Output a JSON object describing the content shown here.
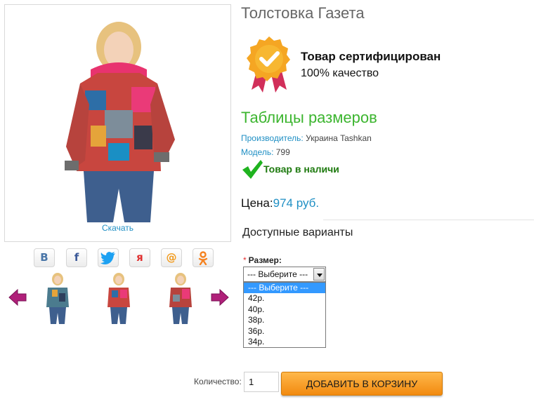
{
  "product": {
    "title": "Толстовка Газета",
    "download_label": "Скачать",
    "main_image_icon": "product-photo-girl-hoodie"
  },
  "share": {
    "buttons": [
      {
        "name": "vk",
        "glyph": "B",
        "color": "#4a76a8"
      },
      {
        "name": "facebook",
        "glyph": "f",
        "color": "#3b5998"
      },
      {
        "name": "twitter",
        "glyph": "🐦",
        "color": "#1da1f2"
      },
      {
        "name": "moimir",
        "glyph": "я",
        "color": "#e03030"
      },
      {
        "name": "mailru",
        "glyph": "@",
        "color": "#f29b1d"
      },
      {
        "name": "odnoklassniki",
        "glyph": "ok",
        "color": "#f58220"
      }
    ]
  },
  "certificate": {
    "title": "Товар сертифицирован",
    "subtitle": "100% качество"
  },
  "size_table_link": "Таблицы размеров",
  "meta": {
    "manufacturer_label": "Производитель:",
    "manufacturer_value": "Украина Tashkan",
    "model_label": "Модель:",
    "model_value": "799"
  },
  "stock": {
    "text": "Товар в наличи"
  },
  "price": {
    "label": "Цена:",
    "value": "974 руб."
  },
  "options": {
    "title": "Доступные варианты",
    "size_label": "Размер:",
    "required_mark": "*",
    "selected": "--- Выберите ---",
    "list": [
      "--- Выберите ---",
      "42р.",
      "40р.",
      "38р.",
      "36р.",
      "34р."
    ]
  },
  "cart": {
    "qty_label": "Количество:",
    "qty_value": "1",
    "add_label": "ДОБАВИТЬ В КОРЗИНУ"
  },
  "colors": {
    "accent_blue": "#1f8fc4",
    "green": "#3cb52f",
    "stock_green": "#1e7a0f",
    "cart_orange": "#f28a10",
    "arrow_magenta": "#b0207a"
  }
}
